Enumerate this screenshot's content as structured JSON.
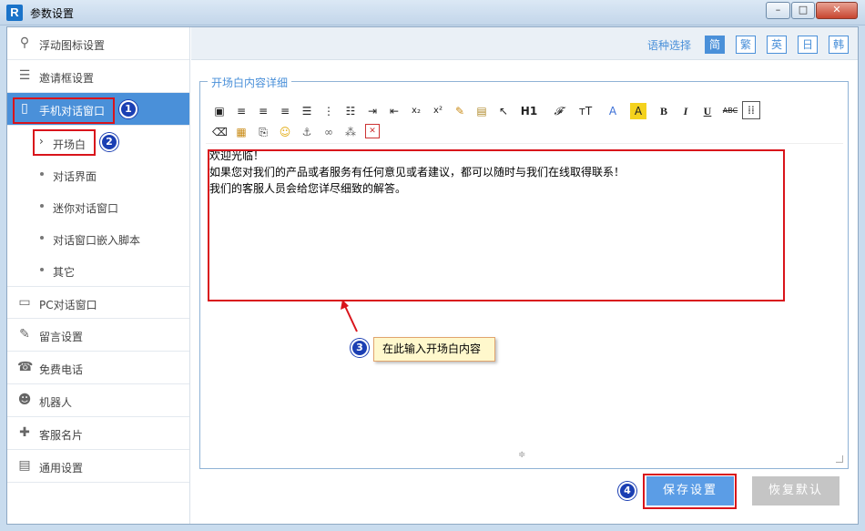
{
  "window": {
    "title": "参数设置",
    "app_icon": "R"
  },
  "title_buttons": {
    "minimize": "–",
    "maximize": "□",
    "close": "✕"
  },
  "sidebar": {
    "items": [
      {
        "label": "浮动图标设置",
        "icon": "pin-icon",
        "glyph": "⚲"
      },
      {
        "label": "邀请框设置",
        "icon": "list-icon",
        "glyph": "☰"
      },
      {
        "label": "手机对话窗口",
        "icon": "phone-icon",
        "glyph": "▯",
        "active": true
      },
      {
        "label": "PC对话窗口",
        "icon": "monitor-icon",
        "glyph": "▭"
      },
      {
        "label": "留言设置",
        "icon": "edit-icon",
        "glyph": "✎"
      },
      {
        "label": "免费电话",
        "icon": "telephone-icon",
        "glyph": "☎"
      },
      {
        "label": "机器人",
        "icon": "robot-icon",
        "glyph": "☻"
      },
      {
        "label": "客服名片",
        "icon": "shield-icon",
        "glyph": "✚"
      },
      {
        "label": "通用设置",
        "icon": "card-icon",
        "glyph": "▤"
      }
    ],
    "sub_items": [
      {
        "label": "开场白",
        "selected": true
      },
      {
        "label": "对话界面"
      },
      {
        "label": "迷你对话窗口"
      },
      {
        "label": "对话窗口嵌入脚本"
      },
      {
        "label": "其它"
      }
    ]
  },
  "language": {
    "label": "语种选择",
    "options": [
      "简",
      "繁",
      "英",
      "日",
      "韩"
    ],
    "selected": "简"
  },
  "panel": {
    "legend": "开场白内容详细"
  },
  "toolbar": {
    "heading": "H1",
    "font": "𝓕",
    "size": "тT",
    "color": "A",
    "bold": "B",
    "italic": "I",
    "underline": "U",
    "strike": "ABC"
  },
  "editor": {
    "lines": [
      "欢迎光临！",
      "如果您对我们的产品或者服务有任何意见或者建议，都可以随时与我们在线取得联系！",
      "我们的客服人员会给您详尽细致的解答。"
    ]
  },
  "annotations": {
    "badges": [
      "1",
      "2",
      "3",
      "4"
    ],
    "tooltip": "在此输入开场白内容"
  },
  "buttons": {
    "save": "保存设置",
    "reset": "恢复默认"
  },
  "colors": {
    "accent": "#4a90d9",
    "annotation_red": "#d9141b",
    "badge_blue": "#1b3fb3"
  }
}
